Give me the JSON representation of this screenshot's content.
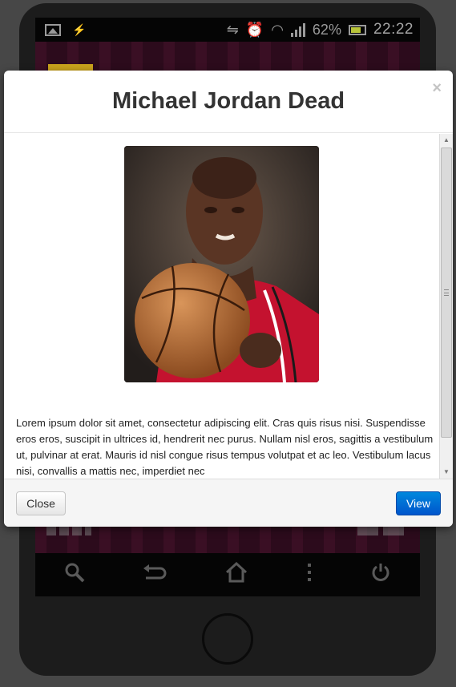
{
  "status_bar": {
    "battery": "62%",
    "time": "22:22"
  },
  "modal": {
    "title": "Michael Jordan Dead",
    "close_glyph": "×",
    "image_alt": "Michael Jordan holding a basketball in a red jersey",
    "body_text": "Lorem ipsum dolor sit amet, consectetur adipiscing elit. Cras quis risus nisi. Suspendisse eros eros, suscipit in ultrices id, hendrerit nec purus. Nullam nisl eros, sagittis a vestibulum ut, pulvinar at erat. Mauris id nisl congue risus tempus volutpat et ac leo. Vestibulum lacus nisi, convallis a mattis nec, imperdiet nec",
    "close_button": "Close",
    "view_button": "View"
  },
  "colors": {
    "primary_button": "#0055cc",
    "title_text": "#333333",
    "backdrop": "#474747"
  },
  "icons": {
    "status_left": [
      "image-icon",
      "usb-icon"
    ],
    "status_right": [
      "vibrate-icon",
      "alarm-icon",
      "wifi-icon",
      "signal-icon",
      "battery-icon"
    ],
    "home_bar": [
      "search-icon",
      "back-icon",
      "home-icon",
      "menu-icon",
      "power-icon"
    ]
  }
}
